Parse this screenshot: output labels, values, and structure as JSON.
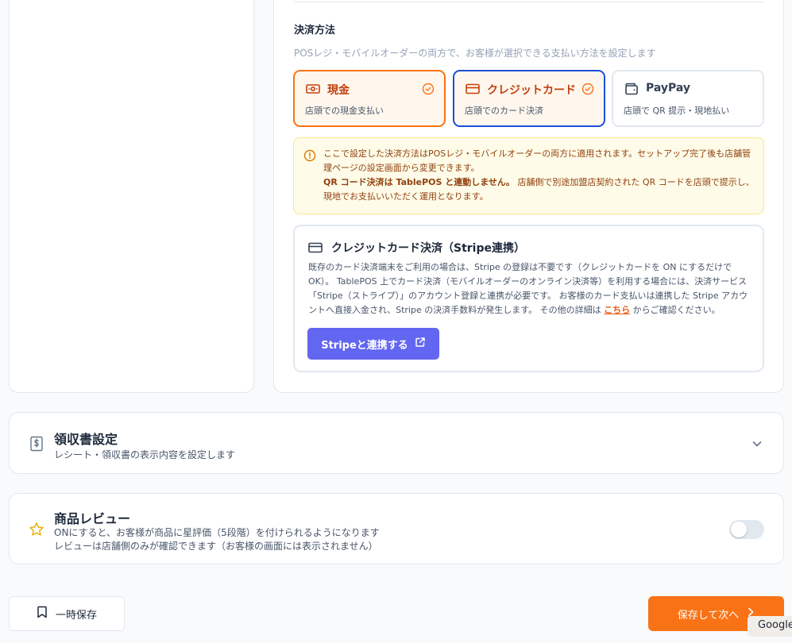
{
  "payment": {
    "title": "決済方法",
    "subtitle": "POSレジ・モバイルオーダーの両方で、お客様が選択できる支払い方法を設定します",
    "options": [
      {
        "label": "現金",
        "desc": "店頭での現金支払い",
        "selected": true,
        "icon": "cash-icon"
      },
      {
        "label": "クレジットカード",
        "desc": "店頭でのカード決済",
        "selected": true,
        "icon": "credit-card-icon"
      },
      {
        "label": "PayPay",
        "desc": "店頭で QR 提示・現地払い",
        "selected": false,
        "icon": "wallet-icon"
      }
    ],
    "notice": {
      "line1": "ここで設定した決済方法はPOSレジ・モバイルオーダーの両方に適用されます。セットアップ完了後も店舗管理ページの設定画面から変更できます。",
      "bold": "QR コード決済は TablePOS と連動しません。",
      "line2": "店舗側で別途加盟店契約された QR コードを店頭で提示し、現地でお支払いいただく運用となります。"
    },
    "stripe": {
      "title": "クレジットカード決済（Stripe連携）",
      "body": "既存のカード決済端末をご利用の場合は、Stripe の登録は不要です（クレジットカードを ON にするだけでOK）。 TablePOS 上でカード決済（モバイルオーダーのオンライン決済等）を利用する場合には、決済サービス「Stripe（ストライプ）」のアカウント登録と連携が必要です。 お客様のカード支払いは連携した Stripe アカウントへ直接入金され、Stripe の決済手数料が発生します。 その他の詳細は",
      "link": "こちら",
      "body_end": "からご確認ください。",
      "button": "Stripeと連携する"
    }
  },
  "receipt": {
    "title": "領収書設定",
    "subtitle": "レシート・領収書の表示内容を設定します"
  },
  "review": {
    "title": "商品レビュー",
    "line1": "ONにすると、お客様が商品に星評価（5段階）を付けられるようになります",
    "line2": "レビューは店舗側のみが確認できます（お客様の画面には表示されません）",
    "enabled": false
  },
  "footer": {
    "draft_label": "一時保存",
    "next_label": "保存して次へ"
  },
  "overlay": {
    "google_label": "Google"
  },
  "colors": {
    "accent": "#f97316",
    "selected_border_blue": "#1d4ed8",
    "stripe": "#6366f1",
    "notice_bg": "#fefce8"
  }
}
